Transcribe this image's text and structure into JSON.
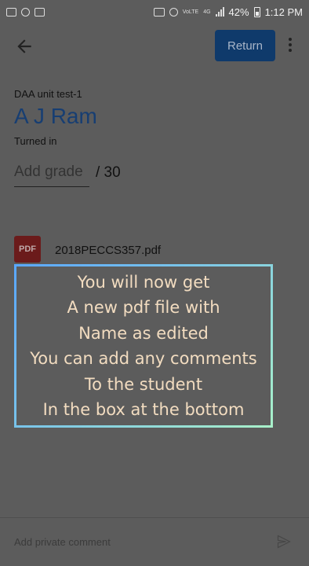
{
  "status_bar": {
    "battery_percent": "42%",
    "time": "1:12 PM",
    "network_label": "4G",
    "volte_label": "VoLTE",
    "icons": [
      "video-icon",
      "apps-icon",
      "image-icon",
      "cast-icon",
      "mute-icon",
      "volte-icon",
      "signal-icon",
      "battery-icon"
    ]
  },
  "app_bar": {
    "back_icon": "arrow-back-icon",
    "return_label": "Return",
    "more_icon": "more-vert-icon",
    "accent_color": "#0f3a6b"
  },
  "submission": {
    "assignment_title": "DAA unit test-1",
    "student_name": "A J Ram",
    "status": "Turned in",
    "grade_placeholder": "Add grade",
    "grade_total": "/ 30"
  },
  "attachment": {
    "icon_label": "PDF",
    "file_name": "2018PECCS357.pdf"
  },
  "overlay_text": [
    "You will now get",
    "A new pdf file with",
    "Name as edited",
    "You can add any comments",
    "To the student",
    "In the box at the bottom"
  ],
  "comment_bar": {
    "placeholder": "Add private comment",
    "send_icon": "send-icon"
  }
}
